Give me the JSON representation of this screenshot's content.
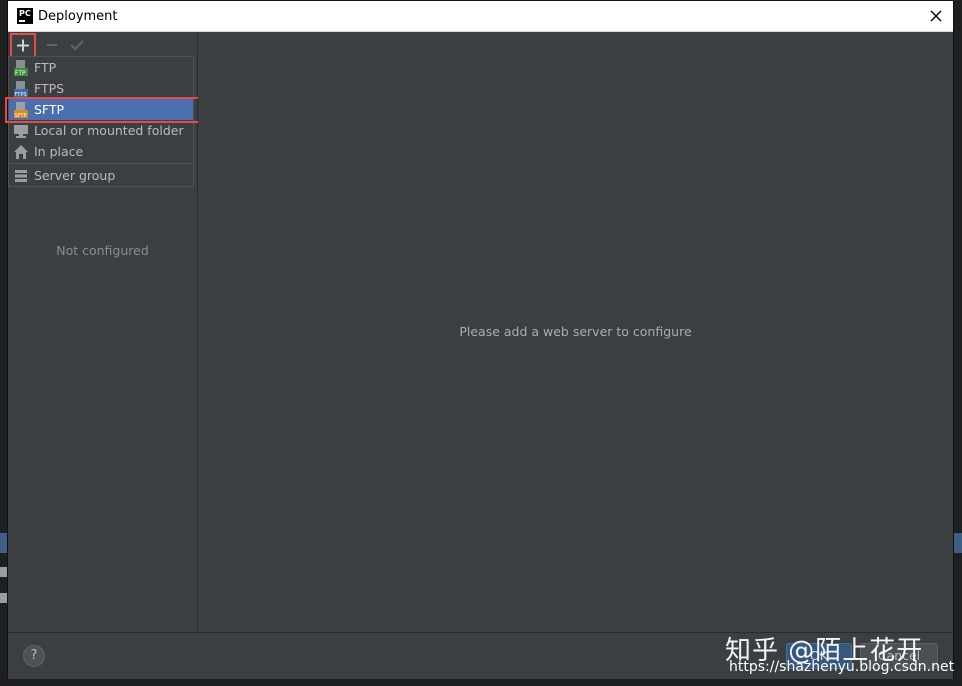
{
  "window": {
    "title": "Deployment",
    "app_icon": "PC"
  },
  "toolbar": {
    "add_icon": "plus-icon",
    "remove_icon": "minus-icon",
    "apply_icon": "check-icon"
  },
  "menu": {
    "items": [
      {
        "label": "FTP",
        "icon": "ftp-icon"
      },
      {
        "label": "FTPS",
        "icon": "ftps-icon"
      },
      {
        "label": "SFTP",
        "icon": "sftp-icon",
        "selected": true
      },
      {
        "label": "Local or mounted folder",
        "icon": "folder-monitor-icon"
      },
      {
        "label": "In place",
        "icon": "home-icon"
      }
    ],
    "group_item": {
      "label": "Server group",
      "icon": "server-group-icon"
    }
  },
  "left_panel": {
    "empty_text": "Not configured"
  },
  "right_panel": {
    "empty_text": "Please add a web server to configure"
  },
  "footer": {
    "help_label": "?",
    "ok_label": "OK",
    "cancel_label": "Cancel"
  },
  "watermark": {
    "text": "知乎 @陌上花开",
    "url": "https://shazhenyu.blog.csdn.net"
  },
  "colors": {
    "selection": "#4b6eaf",
    "highlight_box": "#e84a4a",
    "background": "#3c3f41"
  }
}
